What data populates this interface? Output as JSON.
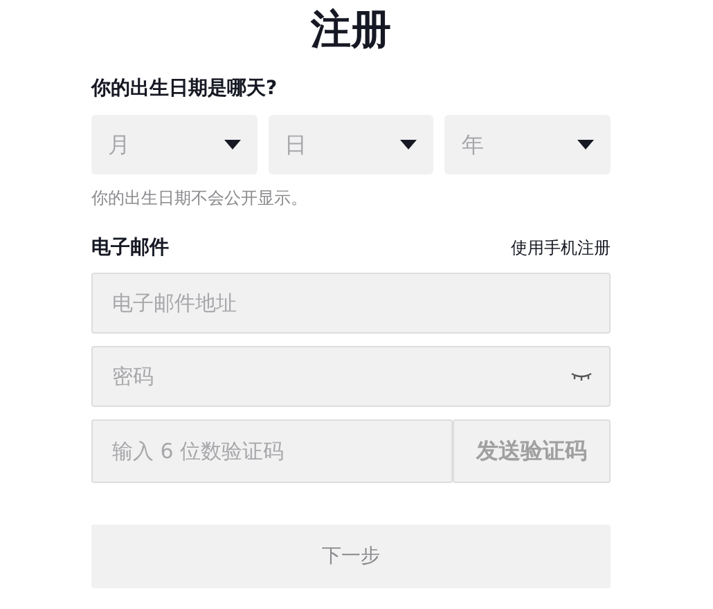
{
  "title": "注册",
  "birthday": {
    "label": "你的出生日期是哪天?",
    "selects": [
      {
        "placeholder": "月"
      },
      {
        "placeholder": "日"
      },
      {
        "placeholder": "年"
      }
    ],
    "hint": "你的出生日期不会公开显示。"
  },
  "email": {
    "label": "电子邮件",
    "switch_link": "使用手机注册",
    "address": {
      "placeholder": "电子邮件地址"
    },
    "password": {
      "placeholder": "密码"
    },
    "code": {
      "placeholder": "输入 6 位数验证码"
    },
    "send_button": "发送验证码"
  },
  "next_button": {
    "label": "下一步",
    "disabled": true
  }
}
